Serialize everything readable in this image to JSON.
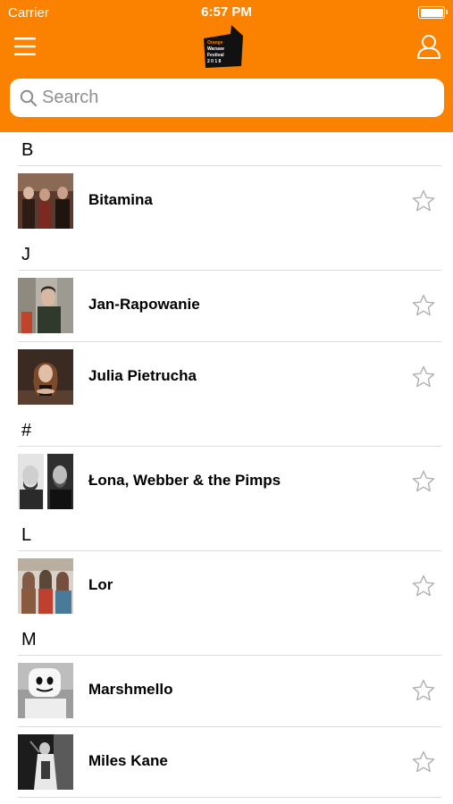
{
  "status_bar": {
    "carrier": "Carrier",
    "time": "6:57 PM"
  },
  "header": {
    "menu_icon": "hamburger-menu-icon",
    "logo_icon": "festival-logo",
    "logo_text": [
      "Orange",
      "Warsaw",
      "Festival",
      "2 0 1 8"
    ],
    "user_icon": "user-profile-icon",
    "accent_color": "#fb8200"
  },
  "search": {
    "placeholder": "Search",
    "value": ""
  },
  "sections": [
    {
      "letter": "B",
      "artists": [
        {
          "name": "Bitamina"
        }
      ]
    },
    {
      "letter": "J",
      "artists": [
        {
          "name": "Jan-Rapowanie"
        },
        {
          "name": "Julia Pietrucha"
        }
      ]
    },
    {
      "letter": "#",
      "artists": [
        {
          "name": "Łona, Webber & the Pimps"
        }
      ]
    },
    {
      "letter": "L",
      "artists": [
        {
          "name": "Lor"
        }
      ]
    },
    {
      "letter": "M",
      "artists": [
        {
          "name": "Marshmello"
        },
        {
          "name": "Miles Kane"
        }
      ]
    }
  ],
  "favorite_icon": "star-outline-icon"
}
